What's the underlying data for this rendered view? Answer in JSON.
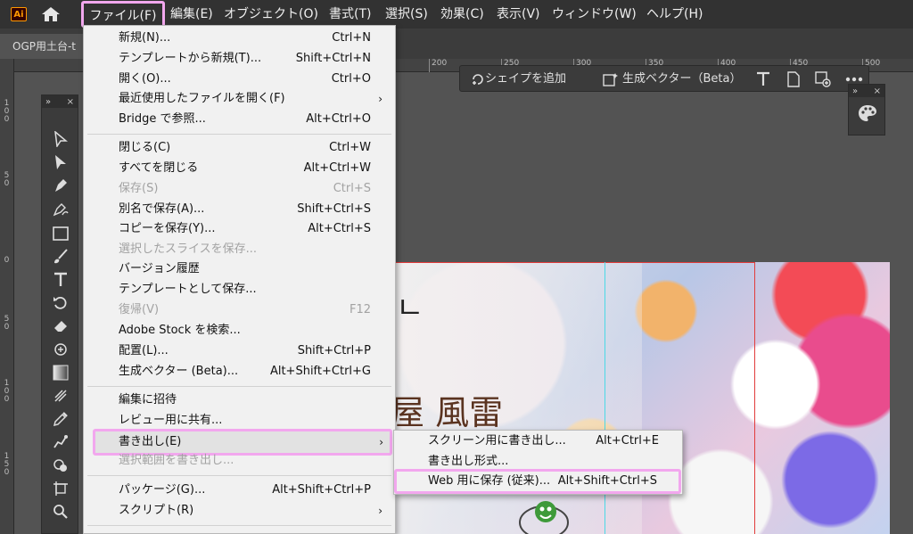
{
  "app_icon": "Ai",
  "menubar": {
    "items": [
      "ファイル(F)",
      "編集(E)",
      "オブジェクト(O)",
      "書式(T)",
      "選択(S)",
      "効果(C)",
      "表示(V)",
      "ウィンドウ(W)",
      "ヘルプ(H)"
    ]
  },
  "tab": {
    "title": "OGP用土台-t"
  },
  "ruler_top": [
    "200",
    "250",
    "300",
    "350",
    "400",
    "450",
    "500"
  ],
  "ruler_left": [
    "1\n0\n0",
    "5\n0",
    "0",
    "5\n0",
    "1\n0\n0",
    "1\n5\n0"
  ],
  "context_bar": {
    "shape_label": "シェイプを追加",
    "gen_label": "生成ベクター（Beta）"
  },
  "artboard": {
    "title": "屋 風雷",
    "mark": "ㄴ"
  },
  "file_menu": {
    "items": [
      {
        "label": "新規(N)...",
        "shortcut": "Ctrl+N"
      },
      {
        "label": "テンプレートから新規(T)...",
        "shortcut": "Shift+Ctrl+N"
      },
      {
        "label": "開く(O)...",
        "shortcut": "Ctrl+O"
      },
      {
        "label": "最近使用したファイルを開く(F)",
        "shortcut": ""
      },
      {
        "label": "Bridge で参照...",
        "shortcut": "Alt+Ctrl+O"
      },
      {
        "label": "閉じる(C)",
        "shortcut": "Ctrl+W"
      },
      {
        "label": "すべてを閉じる",
        "shortcut": "Alt+Ctrl+W"
      },
      {
        "label": "保存(S)",
        "shortcut": "Ctrl+S"
      },
      {
        "label": "別名で保存(A)...",
        "shortcut": "Shift+Ctrl+S"
      },
      {
        "label": "コピーを保存(Y)...",
        "shortcut": "Alt+Ctrl+S"
      },
      {
        "label": "選択したスライスを保存...",
        "shortcut": ""
      },
      {
        "label": "バージョン履歴",
        "shortcut": ""
      },
      {
        "label": "テンプレートとして保存...",
        "shortcut": ""
      },
      {
        "label": "復帰(V)",
        "shortcut": "F12"
      },
      {
        "label": "Adobe Stock を検索...",
        "shortcut": ""
      },
      {
        "label": "配置(L)...",
        "shortcut": "Shift+Ctrl+P"
      },
      {
        "label": "生成ベクター (Beta)...",
        "shortcut": "Alt+Shift+Ctrl+G"
      },
      {
        "label": "編集に招待",
        "shortcut": ""
      },
      {
        "label": "レビュー用に共有...",
        "shortcut": ""
      },
      {
        "label": "書き出し(E)",
        "shortcut": ""
      },
      {
        "label": "選択範囲を書き出し...",
        "shortcut": ""
      },
      {
        "label": "パッケージ(G)...",
        "shortcut": "Alt+Shift+Ctrl+P"
      },
      {
        "label": "スクリプト(R)",
        "shortcut": ""
      }
    ]
  },
  "export_submenu": {
    "items": [
      {
        "label": "スクリーン用に書き出し...",
        "shortcut": "Alt+Ctrl+E"
      },
      {
        "label": "書き出し形式...",
        "shortcut": ""
      },
      {
        "label": "Web 用に保存 (従来)...",
        "shortcut": "Alt+Shift+Ctrl+S"
      }
    ]
  },
  "colors": {
    "highlight": "#f2a7ee",
    "menu_bg": "#f1f1f1",
    "workspace": "#535353"
  }
}
